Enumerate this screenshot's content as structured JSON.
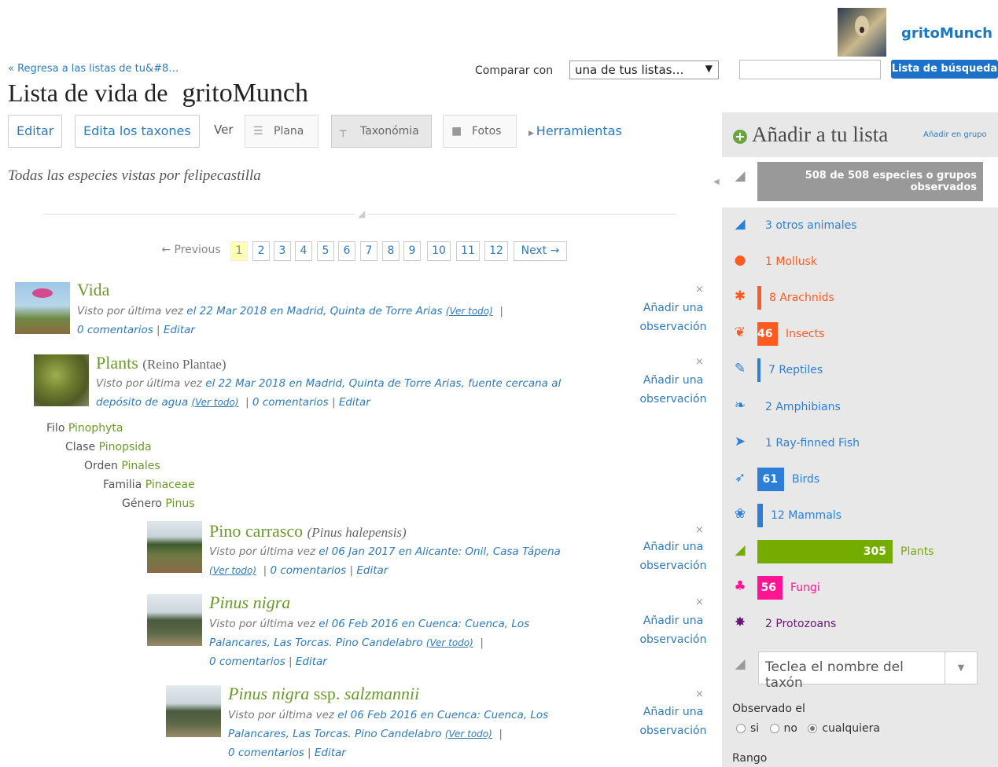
{
  "header": {
    "username": "gritoMunch",
    "back_link": "« Regresa a las listas de tu&#8…",
    "compare_label": "Comparar con",
    "compare_select": "una de tus listas…",
    "search_button": "Lista de búsqueda"
  },
  "title": {
    "prefix": "Lista de vida de",
    "user": "gritoMunch"
  },
  "toolbar": {
    "edit": "Editar",
    "edit_taxa": "Edita los taxones",
    "view_label": "Ver",
    "view_flat": "Plana",
    "view_taxonomy": "Taxonómia",
    "view_photos": "Fotos",
    "tools": "Herramientas"
  },
  "subtitle": "Todas las especies vistas por felipecastilla",
  "pagination": {
    "previous": "← Previous",
    "next": "Next →",
    "pages": [
      "1",
      "2",
      "3",
      "4",
      "5",
      "6",
      "7",
      "8",
      "9",
      "10",
      "11",
      "12"
    ],
    "current": "1"
  },
  "entries": [
    {
      "name": "Vida",
      "meta_prefix": "Visto por última vez",
      "meta_date": "el 22 Mar 2018 en Madrid, Quinta de Torre Arias",
      "view_all": "(Ver todo)",
      "comments": "0 comentarios",
      "edit": "Editar",
      "add": "Añadir una observación"
    },
    {
      "name": "Plants",
      "rank": "(Reino Plantae)",
      "meta_prefix": "Visto por última vez",
      "meta_date": "el 22 Mar 2018 en Madrid, Quinta de Torre Arias, fuente cercana al depósito de agua",
      "view_all": "(Ver todo)",
      "comments": "0 comentarios",
      "edit": "Editar",
      "add": "Añadir una observación"
    },
    {
      "name": "Pino carrasco",
      "sci": "(Pinus halepensis)",
      "meta_prefix": "Visto por última vez",
      "meta_date": "el 06 Jan 2017 en Alicante: Onil, Casa Tápena",
      "view_all": "(Ver todo)",
      "comments": "0 comentarios",
      "edit": "Editar",
      "add": "Añadir una observación"
    },
    {
      "name": "Pinus nigra",
      "meta_prefix": "Visto por última vez",
      "meta_date": "el 06 Feb 2016 en Cuenca: Cuenca, Los Palancares, Las Torcas. Pino Candelabro",
      "view_all": "(Ver todo)",
      "comments": "0 comentarios",
      "edit": "Editar",
      "add": "Añadir una observación"
    },
    {
      "name": "Pinus nigra",
      "name_mid": "ssp.",
      "name_end": "salzmannii",
      "meta_prefix": "Visto por última vez",
      "meta_date": "el 06 Feb 2016 en Cuenca: Cuenca, Los Palancares, Las Torcas. Pino Candelabro",
      "view_all": "(Ver todo)",
      "comments": "0 comentarios",
      "edit": "Editar",
      "add": "Añadir una observación"
    }
  ],
  "taxonomy": [
    {
      "rank": "Filo",
      "name": "Pinophyta"
    },
    {
      "rank": "Clase",
      "name": "Pinopsida"
    },
    {
      "rank": "Orden",
      "name": "Pinales"
    },
    {
      "rank": "Familia",
      "name": "Pinaceae"
    },
    {
      "rank": "Género",
      "name": "Pinus"
    }
  ],
  "sidebar": {
    "title": "Añadir a tu lista",
    "group_link": "Añadir en grupo",
    "all_label": "508 de 508 especies o grupos observados",
    "groups": [
      {
        "count": "3",
        "label": "otros animales",
        "value": 3,
        "color": "#2b7fd6",
        "icon": "bird-icon"
      },
      {
        "count": "1",
        "label": "Mollusk",
        "value": 1,
        "color": "#ff5a1f",
        "icon": "snail-icon"
      },
      {
        "count": "8",
        "label": "Arachnids",
        "value": 8,
        "color": "#ff5a1f",
        "icon": "spider-icon"
      },
      {
        "count": "46",
        "label": "Insects",
        "value": 46,
        "color": "#ff5a1f",
        "icon": "butterfly-icon"
      },
      {
        "count": "7",
        "label": "Reptiles",
        "value": 7,
        "color": "#2b7fd6",
        "icon": "lizard-icon"
      },
      {
        "count": "2",
        "label": "Amphibians",
        "value": 2,
        "color": "#2b7fd6",
        "icon": "frog-icon"
      },
      {
        "count": "1",
        "label": "Ray-finned Fish",
        "value": 1,
        "color": "#2b7fd6",
        "icon": "fish-icon"
      },
      {
        "count": "61",
        "label": "Birds",
        "value": 61,
        "color": "#2b7fd6",
        "icon": "bird-flying-icon"
      },
      {
        "count": "12",
        "label": "Mammals",
        "value": 12,
        "color": "#2b7fd6",
        "icon": "mammal-icon"
      },
      {
        "count": "305",
        "label": "Plants",
        "value": 305,
        "color": "#74ac00",
        "icon": "leaf-icon"
      },
      {
        "count": "56",
        "label": "Fungi",
        "value": 56,
        "color": "#ff1493",
        "icon": "mushroom-icon"
      },
      {
        "count": "2",
        "label": "Protozoans",
        "value": 2,
        "color": "#691776",
        "icon": "protozoan-icon"
      }
    ],
    "taxon_placeholder": "Teclea el nombre del taxón",
    "observed_label": "Observado el",
    "radio_yes": "si",
    "radio_no": "no",
    "radio_any": "cualquiera",
    "rank_label": "Rango"
  }
}
